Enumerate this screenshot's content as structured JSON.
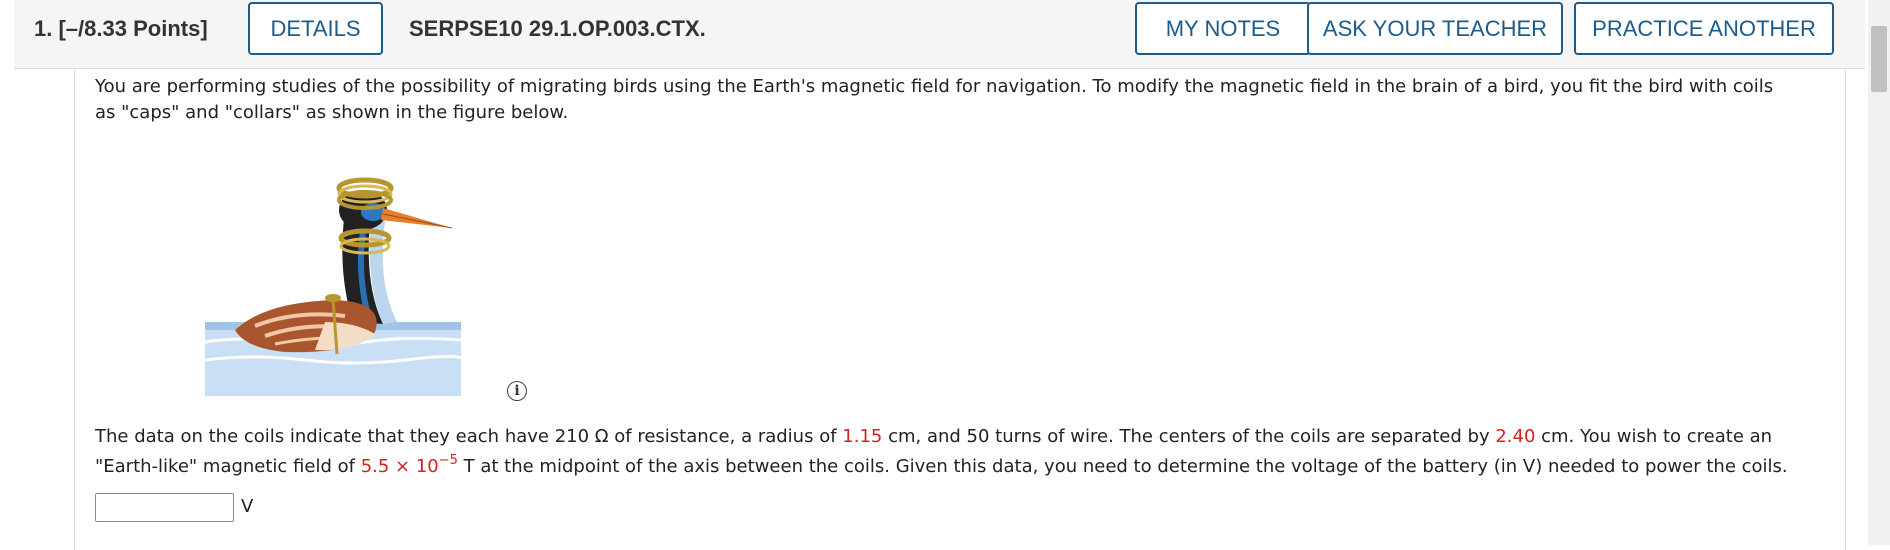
{
  "header": {
    "question_number": "1.",
    "points": "[–/8.33 Points]",
    "details_label": "DETAILS",
    "question_code": "SERPSE10 29.1.OP.003.CTX.",
    "my_notes_label": "MY NOTES",
    "ask_teacher_label": "ASK YOUR TEACHER",
    "practice_another_label": "PRACTICE ANOTHER"
  },
  "body": {
    "intro": "You are performing studies of the possibility of migrating birds using the Earth's magnetic field for navigation. To modify the magnetic field in the brain of a bird, you fit the bird with coils as \"caps\" and \"collars\" as shown in the figure below.",
    "p_part1": "The data on the coils indicate that they each have 210 Ω of resistance, a radius of ",
    "radius_value": "1.15",
    "p_part2": " cm, and 50 turns of wire. The centers of the coils are separated by ",
    "separation_value": "2.40",
    "p_part3": " cm. You wish to create an \"Earth-like\" magnetic field of ",
    "field_mantissa": "5.5 × 10",
    "field_exponent": "−5",
    "p_part4": " T at the midpoint of the axis between the coils. Given this data, you need to determine the voltage of the battery (in V) needed to power the coils.",
    "answer_unit": "V"
  },
  "icons": {
    "info": "info-icon",
    "info_glyph": "i"
  },
  "colors": {
    "accent": "#1d5b8c",
    "given_value": "#d92020"
  }
}
